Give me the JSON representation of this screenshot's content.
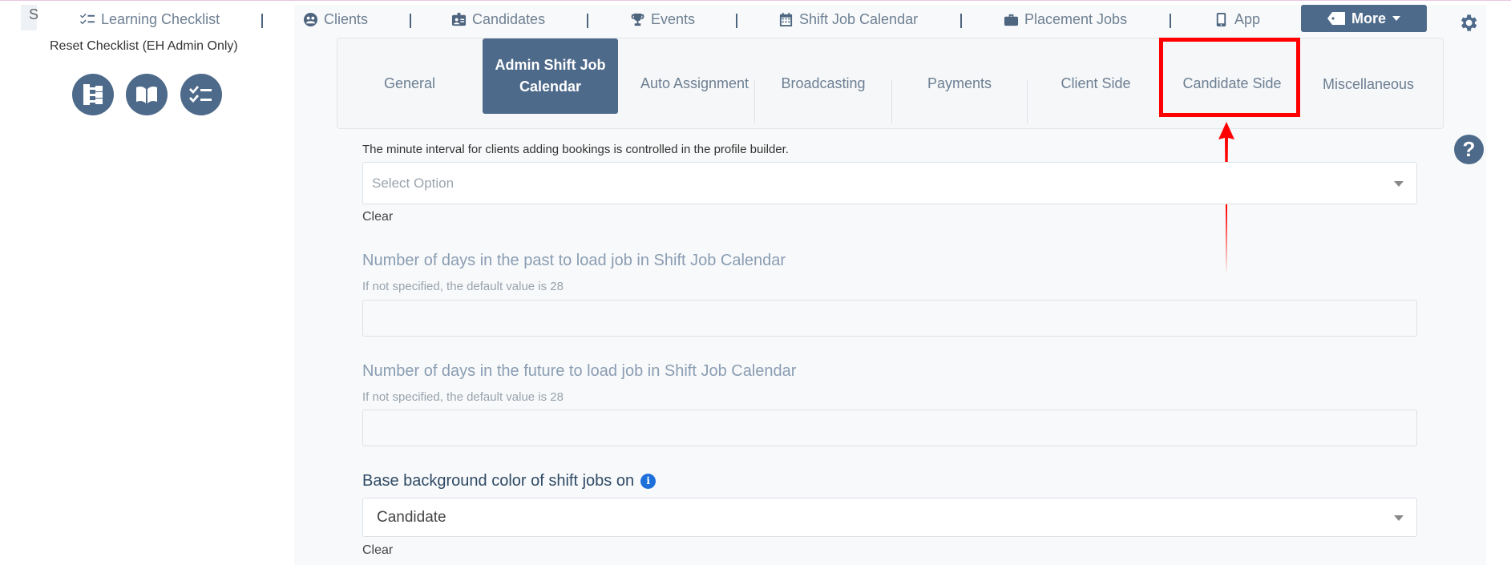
{
  "topnav": {
    "cut_tab": "S",
    "items": [
      {
        "label": "Learning Checklist",
        "icon": "checklist-icon"
      },
      {
        "label": "Clients",
        "icon": "clients-icon"
      },
      {
        "label": "Candidates",
        "icon": "candidates-icon"
      },
      {
        "label": "Events",
        "icon": "trophy-icon"
      },
      {
        "label": "Shift Job Calendar",
        "icon": "calendar-icon"
      },
      {
        "label": "Placement Jobs",
        "icon": "briefcase-icon"
      },
      {
        "label": "App",
        "icon": "mobile-icon"
      }
    ],
    "more_label": "More"
  },
  "left_panel": {
    "reset_label": "Reset Checklist (EH Admin Only)",
    "icons": [
      "sitemap-icon",
      "book-icon",
      "checklist-icon"
    ]
  },
  "tabs": {
    "items": [
      {
        "label": "General"
      },
      {
        "label": "Admin Shift Job Calendar",
        "active": true
      },
      {
        "label": "Auto Assignment"
      },
      {
        "label": "Broadcasting"
      },
      {
        "label": "Payments"
      },
      {
        "label": "Client Side"
      },
      {
        "label": "Candidate Side",
        "highlighted": true
      },
      {
        "label": "Miscellaneous"
      }
    ]
  },
  "form": {
    "top_hint": "The minute interval for clients adding bookings is controlled in the profile builder.",
    "interval_select": {
      "placeholder": "Select Option"
    },
    "clear_1": "Clear",
    "past_days": {
      "label": "Number of days in the past to load job in Shift Job Calendar",
      "hint": "If not specified, the default value is 28",
      "value": ""
    },
    "future_days": {
      "label": "Number of days in the future to load job in Shift Job Calendar",
      "hint": "If not specified, the default value is 28",
      "value": ""
    },
    "bg_color": {
      "label": "Base background color of shift jobs on",
      "info_icon": "i",
      "selected": "Candidate"
    },
    "clear_2": "Clear"
  },
  "help_icon": "?",
  "colors": {
    "primary": "#4e6a8a",
    "highlight": "#ff0000",
    "info": "#1e6fd9"
  }
}
